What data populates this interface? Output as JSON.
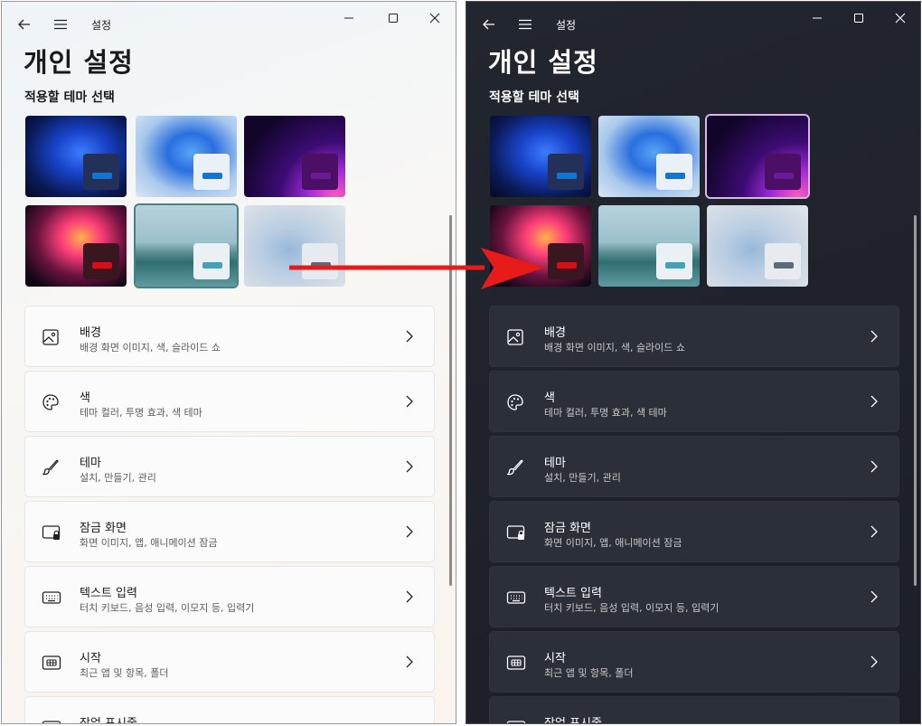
{
  "light": {
    "app_title": "설정",
    "page_title": "개인 설정",
    "section_title": "적용할 테마 선택",
    "items": [
      {
        "label": "배경",
        "sub": "배경 화면 이미지, 색, 슬라이드 쇼",
        "icon": "image-icon"
      },
      {
        "label": "색",
        "sub": "테마 컬러, 투명 효과, 색 테마",
        "icon": "palette-icon"
      },
      {
        "label": "테마",
        "sub": "설치, 만들기, 관리",
        "icon": "brush-icon"
      },
      {
        "label": "잠금 화면",
        "sub": "화면 이미지, 앱, 애니메이션 잠금",
        "icon": "lock-screen-icon"
      },
      {
        "label": "텍스트 입력",
        "sub": "터치 키보드, 음성 입력, 이모지 등, 입력기",
        "icon": "keyboard-icon"
      },
      {
        "label": "시작",
        "sub": "최근 앱 및 항목, 폴더",
        "icon": "start-icon"
      },
      {
        "label": "작업 표시줄",
        "sub": "",
        "icon": "taskbar-icon"
      }
    ]
  },
  "dark": {
    "app_title": "설정",
    "page_title": "개인 설정",
    "section_title": "적용할 테마 선택",
    "items": [
      {
        "label": "배경",
        "sub": "배경 화면 이미지, 색, 슬라이드 쇼",
        "icon": "image-icon"
      },
      {
        "label": "색",
        "sub": "테마 컬러, 투명 효과, 색 테마",
        "icon": "palette-icon"
      },
      {
        "label": "테마",
        "sub": "설치, 만들기, 관리",
        "icon": "brush-icon"
      },
      {
        "label": "잠금 화면",
        "sub": "화면 이미지, 앱, 애니메이션 잠금",
        "icon": "lock-screen-icon"
      },
      {
        "label": "텍스트 입력",
        "sub": "터치 키보드, 음성 입력, 이모지 등, 입력기",
        "icon": "keyboard-icon"
      },
      {
        "label": "시작",
        "sub": "최근 앱 및 항목, 폴더",
        "icon": "start-icon"
      },
      {
        "label": "작업 표시줄",
        "sub": "",
        "icon": "taskbar-icon"
      }
    ]
  },
  "themes": [
    {
      "name": "windows-light-blue",
      "accent": "#0a78d4",
      "swatch_light": "#2a3350",
      "swatch_dark": "#2a3350"
    },
    {
      "name": "windows-dark-blue",
      "accent": "#0a78d4",
      "swatch_light": "#e9eef5",
      "swatch_dark": "#e9eef5"
    },
    {
      "name": "glow-purple",
      "accent": "#6b1a9a",
      "swatch_light": "#4a1066",
      "swatch_dark": "#4a1066"
    },
    {
      "name": "captured-motion",
      "accent": "#d0111b",
      "swatch_light": "#3a1018",
      "swatch_dark": "#3a1018"
    },
    {
      "name": "sunrise-lake",
      "accent": "#4aa0b2",
      "swatch_light": "#e9eef2",
      "swatch_dark": "#e9eef2"
    },
    {
      "name": "flow",
      "accent": "#5e6a78",
      "swatch_light": "#e6eaef",
      "swatch_dark": "#e6eaef"
    }
  ],
  "selected_theme_light": 4,
  "selected_theme_dark": 2,
  "colors": {
    "arrow": "#e81b1b",
    "selection_light": "#4b7f86",
    "selection_dark": "#d9b6e6"
  }
}
